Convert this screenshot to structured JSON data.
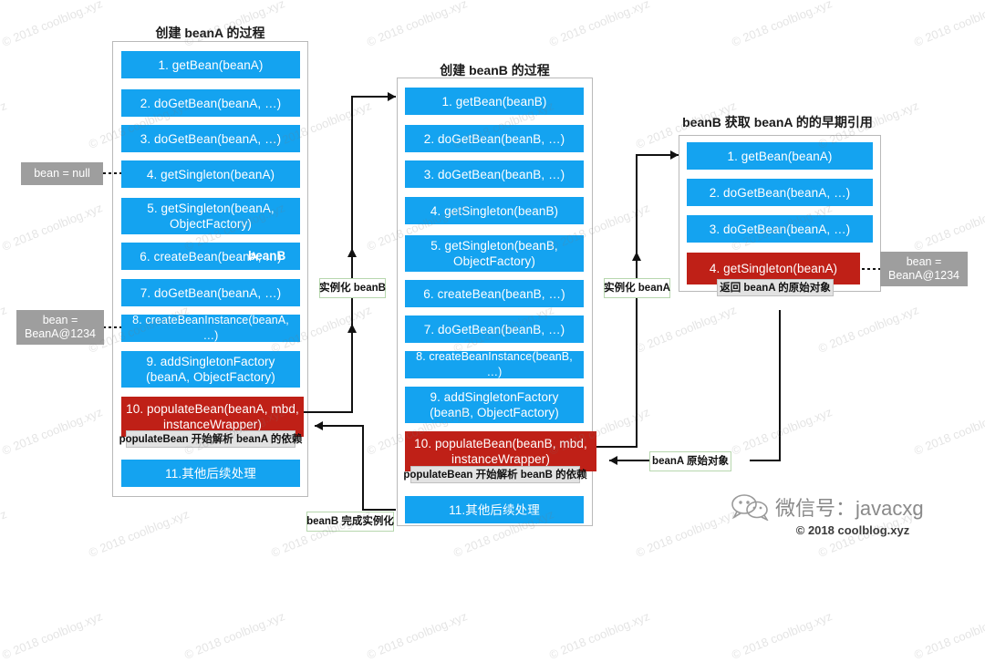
{
  "panels": [
    {
      "id": "beanA",
      "title": "创建 beanA 的过程",
      "steps": [
        {
          "text": "1. getBean(beanA)",
          "color": "blue"
        },
        {
          "text": "2. doGetBean(beanA, …)",
          "color": "blue"
        },
        {
          "text": "3. doGetBean(beanA, …)",
          "color": "blue"
        },
        {
          "text": "4. getSingleton(beanA)",
          "color": "blue"
        },
        {
          "line1": "5. getSingleton(beanA,",
          "line2": "ObjectFactory)",
          "color": "blue"
        },
        {
          "text": "6. createBean(beanA, …)",
          "color": "blue",
          "ghost": "beanB"
        },
        {
          "text": "7. doGetBean(beanA, …)",
          "color": "blue"
        },
        {
          "text": "8. createBeanInstance(beanA, …)",
          "color": "blue"
        },
        {
          "line1": "9. addSingletonFactory",
          "line2": "(beanA, ObjectFactory)",
          "color": "blue"
        },
        {
          "line1": "10. populateBean(beanA, mbd,",
          "line2": "instanceWrapper)",
          "color": "red"
        },
        {
          "text": "11.其他后续处理",
          "color": "blue"
        }
      ],
      "note": "populateBean 开始解析 beanA 的依赖"
    },
    {
      "id": "beanB",
      "title": "创建 beanB 的过程",
      "steps": [
        {
          "text": "1. getBean(beanB)",
          "color": "blue"
        },
        {
          "text": "2. doGetBean(beanB, …)",
          "color": "blue"
        },
        {
          "text": "3. doGetBean(beanB, …)",
          "color": "blue"
        },
        {
          "text": "4. getSingleton(beanB)",
          "color": "blue"
        },
        {
          "line1": "5. getSingleton(beanB,",
          "line2": "ObjectFactory)",
          "color": "blue"
        },
        {
          "text": "6. createBean(beanB, …)",
          "color": "blue"
        },
        {
          "text": "7. doGetBean(beanB, …)",
          "color": "blue"
        },
        {
          "text": "8. createBeanInstance(beanB, …)",
          "color": "blue"
        },
        {
          "line1": "9. addSingletonFactory",
          "line2": "(beanB, ObjectFactory)",
          "color": "blue"
        },
        {
          "line1": "10. populateBean(beanB, mbd,",
          "line2": "instanceWrapper)",
          "color": "red"
        },
        {
          "text": "11.其他后续处理",
          "color": "blue"
        }
      ],
      "note": "populateBean 开始解析 beanB 的依赖"
    },
    {
      "id": "early",
      "title": "beanB 获取 beanA 的的早期引用",
      "steps": [
        {
          "text": "1. getBean(beanA)",
          "color": "blue"
        },
        {
          "text": "2. doGetBean(beanA, …)",
          "color": "blue"
        },
        {
          "text": "3. doGetBean(beanA, …)",
          "color": "blue"
        },
        {
          "text": "4. getSingleton(beanA)",
          "color": "red"
        }
      ],
      "note": "返回 beanA 的原始对象"
    }
  ],
  "value_labels": [
    {
      "id": "bean-null",
      "text": "bean = null"
    },
    {
      "id": "bean-left-ref",
      "line1": "bean =",
      "line2": "BeanA@1234"
    },
    {
      "id": "bean-right-ref",
      "line1": "bean =",
      "line2": "BeanA@1234"
    }
  ],
  "edge_labels": [
    {
      "id": "instantiate-beanb",
      "text": "实例化 beanB"
    },
    {
      "id": "instantiate-beana",
      "text": "实例化 beanA"
    },
    {
      "id": "beana-raw-object",
      "text": "beanA 原始对象"
    },
    {
      "id": "beanb-finished",
      "text": "beanB 完成实例化"
    }
  ],
  "footer": {
    "wechat": "微信号：javacxg",
    "copyright": "© 2018 coolblog.xyz"
  },
  "watermark": {
    "text": "© 2018 coolblog.xyz"
  },
  "colors": {
    "blue": "#14a3f0",
    "red": "#bf2017",
    "grey_label": "#9e9e9e",
    "note_bg": "#e2e2e2",
    "edge_label_border": "#b7d7ae",
    "panel_border": "#b9b9b9",
    "connector": "#111111"
  }
}
